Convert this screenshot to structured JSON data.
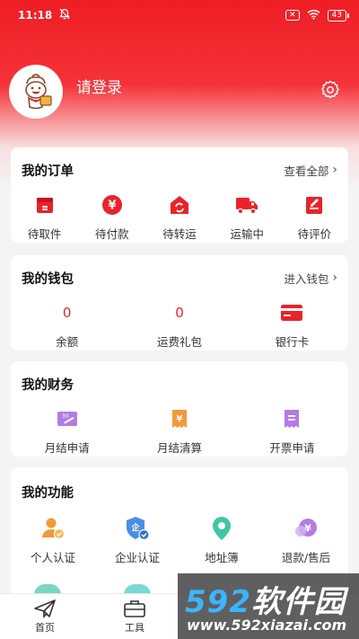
{
  "status_bar": {
    "time": "11:18",
    "sim_label": "✕",
    "battery": "43"
  },
  "profile": {
    "login_text": "请登录"
  },
  "orders": {
    "title": "我的订单",
    "link": "查看全部",
    "items": [
      {
        "label": "待取件",
        "icon": "package-pickup-icon"
      },
      {
        "label": "待付款",
        "icon": "yen-payment-icon"
      },
      {
        "label": "待转运",
        "icon": "transfer-house-icon"
      },
      {
        "label": "运输中",
        "icon": "truck-icon"
      },
      {
        "label": "待评价",
        "icon": "review-edit-icon"
      }
    ]
  },
  "wallet": {
    "title": "我的钱包",
    "link": "进入钱包",
    "balance_value": "0",
    "balance_label": "余额",
    "gift_value": "0",
    "gift_label": "运费礼包",
    "bank_label": "银行卡"
  },
  "finance": {
    "title": "我的财务",
    "items": [
      {
        "label": "月结申请",
        "icon": "monthly-apply-icon"
      },
      {
        "label": "月结清算",
        "icon": "monthly-settle-icon"
      },
      {
        "label": "开票申请",
        "icon": "invoice-icon"
      }
    ]
  },
  "functions": {
    "title": "我的功能",
    "items": [
      {
        "label": "个人认证",
        "icon": "personal-verify-icon"
      },
      {
        "label": "企业认证",
        "icon": "enterprise-verify-icon"
      },
      {
        "label": "地址簿",
        "icon": "location-pin-icon"
      },
      {
        "label": "退款/售后",
        "icon": "refund-icon"
      }
    ]
  },
  "tabbar": {
    "home": "首页",
    "tools": "工具"
  },
  "watermark": {
    "brand_num": "592",
    "brand_text": "软件园",
    "url": "www.592xiazai.com"
  },
  "colors": {
    "accent_red": "#e8232b",
    "header_red": "#ef1d24",
    "finance_purple": "#b47be3",
    "finance_orange": "#f29a3a",
    "pin_teal": "#3fc7a4"
  }
}
